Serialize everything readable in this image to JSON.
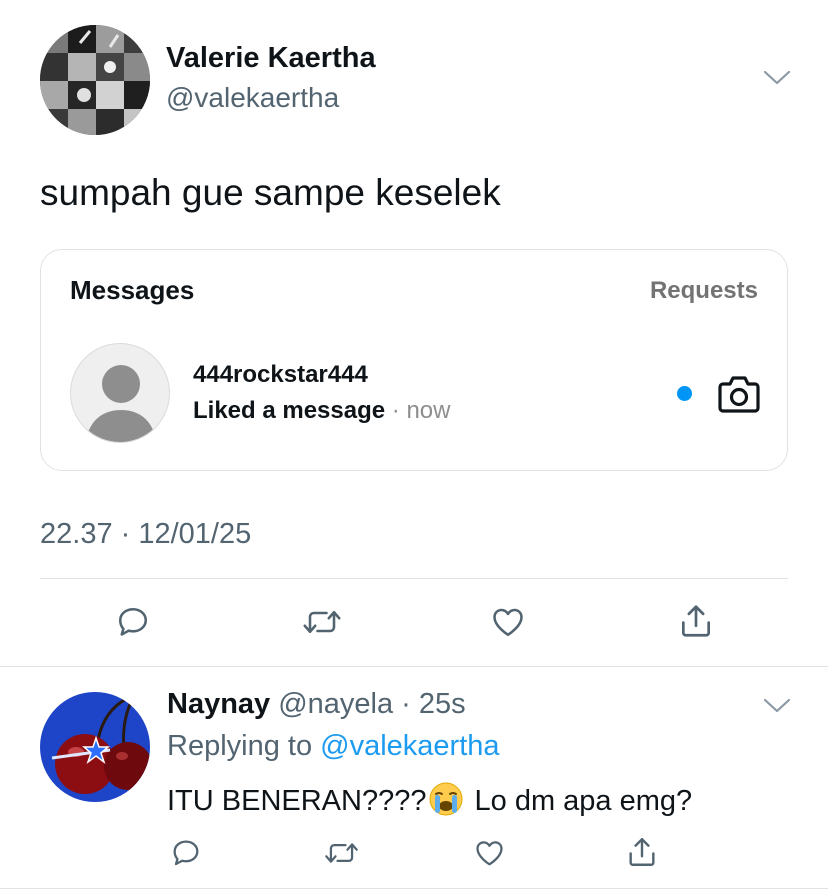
{
  "tweet": {
    "author_name": "Valerie Kaertha",
    "author_handle": "@valekaertha",
    "text": "sumpah gue sampe keselek",
    "timestamp": "22.37 · 12/01/25",
    "icons": {
      "avatar": "profile-photo-collage",
      "more": "chevron-down-icon",
      "reply": "reply-icon",
      "retweet": "retweet-icon",
      "like": "heart-icon",
      "share": "share-icon"
    }
  },
  "embedded_card": {
    "title": "Messages",
    "requests_label": "Requests",
    "thread": {
      "username": "444rockstar444",
      "status": "Liked a message",
      "separator": "·",
      "time": "now",
      "unread_color": "#0095f6",
      "camera_icon": "camera-icon"
    }
  },
  "reply": {
    "author_name": "Naynay",
    "handle_and_time": "@nayela · 25s",
    "replying_prefix": "Replying to",
    "replying_mention": "@valekaertha",
    "text_before_emoji": "ITU BENERAN????",
    "emoji": "loudly-crying-face",
    "text_after_emoji": "Lo dm apa emg?"
  },
  "colors": {
    "text": "#0f1419",
    "secondary": "#536471",
    "link": "#1d9bf0",
    "divider": "#dfe3e7"
  }
}
